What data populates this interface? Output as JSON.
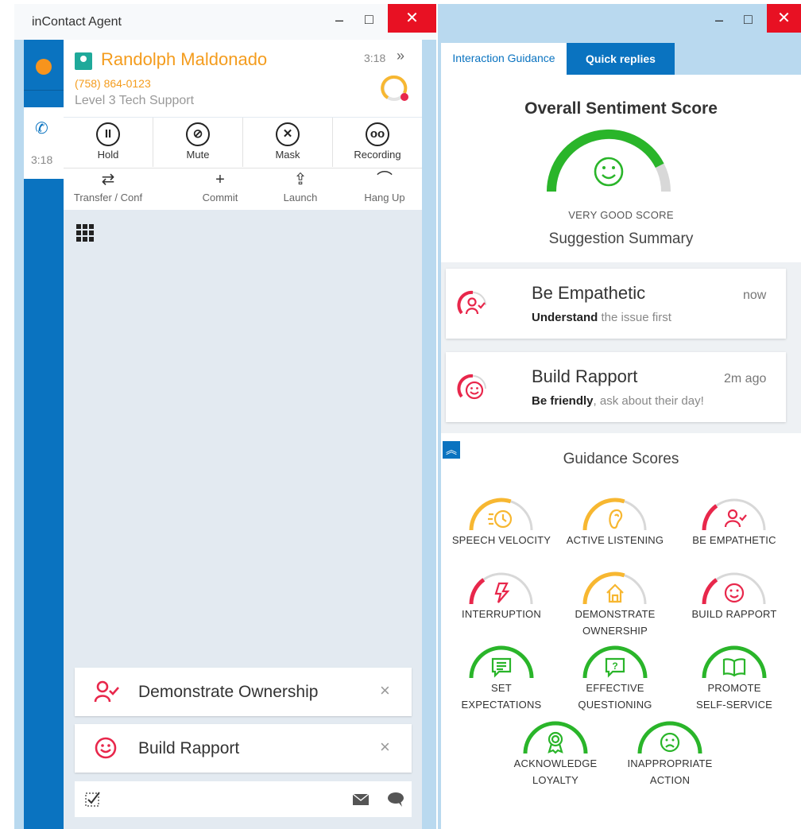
{
  "left_window": {
    "title": "inContact Agent",
    "controls": {
      "minimize": "–",
      "maximize": "□",
      "close": "✕"
    },
    "rail": {
      "call_time": "3:18"
    },
    "contact": {
      "name": "Randolph Maldonado",
      "phone": "(758) 864-0123",
      "skill": "Level 3 Tech Support",
      "time": "3:18",
      "expand": "»"
    },
    "actions_row1": [
      {
        "label": "Hold",
        "glyph": "II"
      },
      {
        "label": "Mute",
        "glyph": "⊘"
      },
      {
        "label": "Mask",
        "glyph": "✕"
      },
      {
        "label": "Recording",
        "glyph": "oo"
      }
    ],
    "actions_row2": [
      {
        "label": "Transfer / Conf",
        "glyph": "⇄"
      },
      {
        "label": "Commit",
        "glyph": "+"
      },
      {
        "label": "Launch",
        "glyph": "⇪"
      },
      {
        "label": "Hang Up",
        "glyph": "⌒"
      }
    ],
    "suggestions": [
      {
        "label": "Demonstrate Ownership",
        "close": "×"
      },
      {
        "label": "Build Rapport",
        "close": "×"
      }
    ]
  },
  "right_window": {
    "controls": {
      "minimize": "–",
      "maximize": "□",
      "close": "✕"
    },
    "tabs": [
      {
        "label": "Interaction Guidance",
        "active": true
      },
      {
        "label": "Quick replies",
        "active": false
      }
    ],
    "sentiment": {
      "title": "Overall Sentiment Score",
      "score_label": "VERY GOOD SCORE",
      "level": 0.85
    },
    "summary_title": "Suggestion Summary",
    "summary": [
      {
        "title": "Be Empathetic",
        "time": "now",
        "bold": "Understand",
        "rest": " the issue first"
      },
      {
        "title": "Build Rapport",
        "time": "2m ago",
        "bold": "Be friendly",
        "rest": ", ask about their day!"
      }
    ],
    "collapse_glyph": "︽",
    "scores_title": "Guidance Scores",
    "scores": [
      {
        "line1": "SPEECH VELOCITY",
        "line2": "",
        "icon": "clock-icon",
        "status": "warning",
        "level": 0.6
      },
      {
        "line1": "ACTIVE LISTENING",
        "line2": "",
        "icon": "ear-icon",
        "status": "warning",
        "level": 0.6
      },
      {
        "line1": "BE EMPATHETIC",
        "line2": "",
        "icon": "person-check-icon",
        "status": "poor",
        "level": 0.3
      },
      {
        "line1": "INTERRUPTION",
        "line2": "",
        "icon": "lightning-icon",
        "status": "poor",
        "level": 0.3
      },
      {
        "line1": "DEMONSTRATE",
        "line2": "OWNERSHIP",
        "icon": "house-icon",
        "status": "warning",
        "level": 0.6
      },
      {
        "line1": "BUILD RAPPORT",
        "line2": "",
        "icon": "smile-icon",
        "status": "poor",
        "level": 0.3
      },
      {
        "line1": "SET",
        "line2": "EXPECTATIONS",
        "icon": "list-bubble-icon",
        "status": "good",
        "level": 1.0
      },
      {
        "line1": "EFFECTIVE",
        "line2": "QUESTIONING",
        "icon": "question-bubble-icon",
        "status": "good",
        "level": 1.0
      },
      {
        "line1": "PROMOTE",
        "line2": "SELF-SERVICE",
        "icon": "book-icon",
        "status": "good",
        "level": 1.0
      },
      {
        "line1": "ACKNOWLEDGE",
        "line2": "LOYALTY",
        "icon": "ribbon-icon",
        "status": "good",
        "level": 1.0
      },
      {
        "line1": "INAPPROPRIATE",
        "line2": "ACTION",
        "icon": "frown-icon",
        "status": "good",
        "level": 1.0
      }
    ]
  },
  "colors": {
    "accent": "#0a73c0",
    "orange": "#f49c1d",
    "good": "#2ab52a",
    "warning": "#f7b731",
    "poor": "#e8274b",
    "track": "#d8d8d8"
  }
}
